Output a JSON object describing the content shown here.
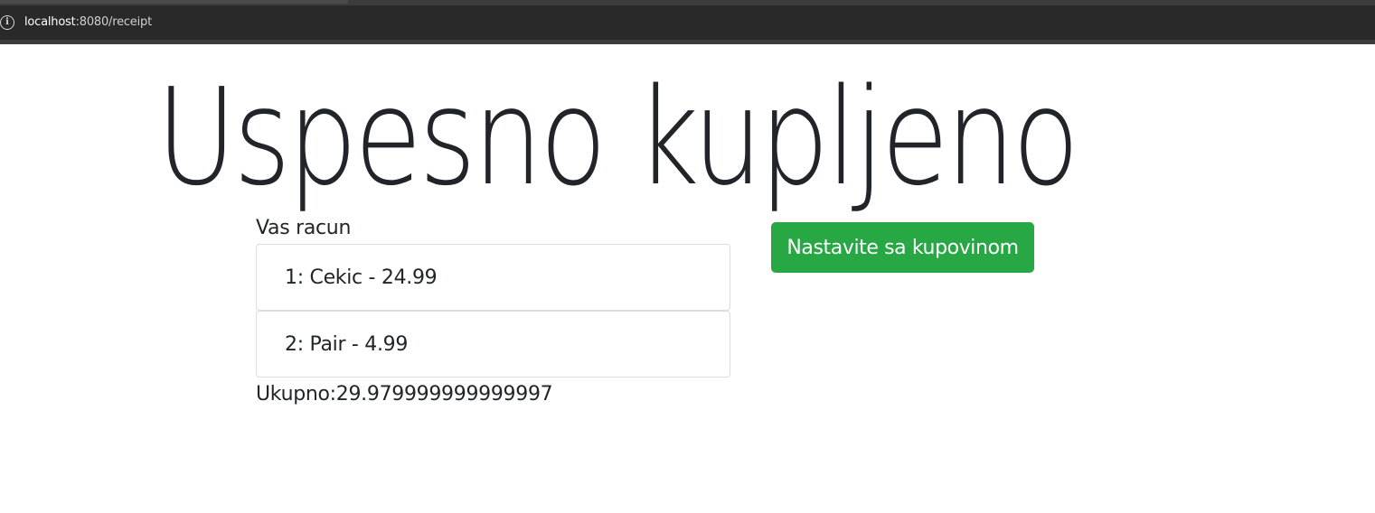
{
  "browser": {
    "url_host": "localhost",
    "url_rest": ":8080/receipt"
  },
  "page": {
    "title": "Uspesno kupljeno",
    "receipt_label": "Vas racun",
    "items": [
      {
        "text": "1: Cekic - 24.99"
      },
      {
        "text": "2: Pair - 4.99"
      }
    ],
    "total": "Ukupno:29.979999999999997",
    "continue_label": "Nastavite sa kupovinom"
  },
  "colors": {
    "button_bg": "#28a745",
    "text": "#212529"
  },
  "icons": {
    "site_info": "info-icon"
  }
}
